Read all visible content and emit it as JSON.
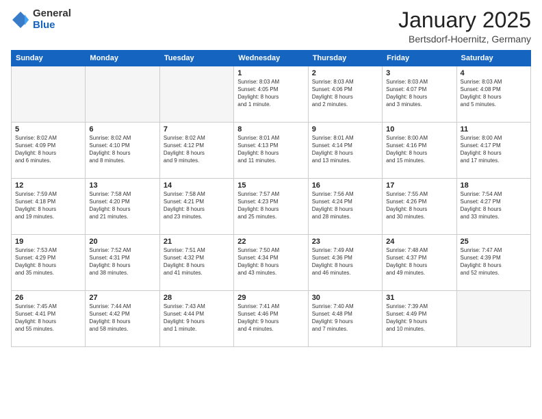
{
  "logo": {
    "general": "General",
    "blue": "Blue"
  },
  "title": "January 2025",
  "location": "Bertsdorf-Hoernitz, Germany",
  "weekdays": [
    "Sunday",
    "Monday",
    "Tuesday",
    "Wednesday",
    "Thursday",
    "Friday",
    "Saturday"
  ],
  "weeks": [
    [
      {
        "day": "",
        "content": ""
      },
      {
        "day": "",
        "content": ""
      },
      {
        "day": "",
        "content": ""
      },
      {
        "day": "1",
        "content": "Sunrise: 8:03 AM\nSunset: 4:05 PM\nDaylight: 8 hours\nand 1 minute."
      },
      {
        "day": "2",
        "content": "Sunrise: 8:03 AM\nSunset: 4:06 PM\nDaylight: 8 hours\nand 2 minutes."
      },
      {
        "day": "3",
        "content": "Sunrise: 8:03 AM\nSunset: 4:07 PM\nDaylight: 8 hours\nand 3 minutes."
      },
      {
        "day": "4",
        "content": "Sunrise: 8:03 AM\nSunset: 4:08 PM\nDaylight: 8 hours\nand 5 minutes."
      }
    ],
    [
      {
        "day": "5",
        "content": "Sunrise: 8:02 AM\nSunset: 4:09 PM\nDaylight: 8 hours\nand 6 minutes."
      },
      {
        "day": "6",
        "content": "Sunrise: 8:02 AM\nSunset: 4:10 PM\nDaylight: 8 hours\nand 8 minutes."
      },
      {
        "day": "7",
        "content": "Sunrise: 8:02 AM\nSunset: 4:12 PM\nDaylight: 8 hours\nand 9 minutes."
      },
      {
        "day": "8",
        "content": "Sunrise: 8:01 AM\nSunset: 4:13 PM\nDaylight: 8 hours\nand 11 minutes."
      },
      {
        "day": "9",
        "content": "Sunrise: 8:01 AM\nSunset: 4:14 PM\nDaylight: 8 hours\nand 13 minutes."
      },
      {
        "day": "10",
        "content": "Sunrise: 8:00 AM\nSunset: 4:16 PM\nDaylight: 8 hours\nand 15 minutes."
      },
      {
        "day": "11",
        "content": "Sunrise: 8:00 AM\nSunset: 4:17 PM\nDaylight: 8 hours\nand 17 minutes."
      }
    ],
    [
      {
        "day": "12",
        "content": "Sunrise: 7:59 AM\nSunset: 4:18 PM\nDaylight: 8 hours\nand 19 minutes."
      },
      {
        "day": "13",
        "content": "Sunrise: 7:58 AM\nSunset: 4:20 PM\nDaylight: 8 hours\nand 21 minutes."
      },
      {
        "day": "14",
        "content": "Sunrise: 7:58 AM\nSunset: 4:21 PM\nDaylight: 8 hours\nand 23 minutes."
      },
      {
        "day": "15",
        "content": "Sunrise: 7:57 AM\nSunset: 4:23 PM\nDaylight: 8 hours\nand 25 minutes."
      },
      {
        "day": "16",
        "content": "Sunrise: 7:56 AM\nSunset: 4:24 PM\nDaylight: 8 hours\nand 28 minutes."
      },
      {
        "day": "17",
        "content": "Sunrise: 7:55 AM\nSunset: 4:26 PM\nDaylight: 8 hours\nand 30 minutes."
      },
      {
        "day": "18",
        "content": "Sunrise: 7:54 AM\nSunset: 4:27 PM\nDaylight: 8 hours\nand 33 minutes."
      }
    ],
    [
      {
        "day": "19",
        "content": "Sunrise: 7:53 AM\nSunset: 4:29 PM\nDaylight: 8 hours\nand 35 minutes."
      },
      {
        "day": "20",
        "content": "Sunrise: 7:52 AM\nSunset: 4:31 PM\nDaylight: 8 hours\nand 38 minutes."
      },
      {
        "day": "21",
        "content": "Sunrise: 7:51 AM\nSunset: 4:32 PM\nDaylight: 8 hours\nand 41 minutes."
      },
      {
        "day": "22",
        "content": "Sunrise: 7:50 AM\nSunset: 4:34 PM\nDaylight: 8 hours\nand 43 minutes."
      },
      {
        "day": "23",
        "content": "Sunrise: 7:49 AM\nSunset: 4:36 PM\nDaylight: 8 hours\nand 46 minutes."
      },
      {
        "day": "24",
        "content": "Sunrise: 7:48 AM\nSunset: 4:37 PM\nDaylight: 8 hours\nand 49 minutes."
      },
      {
        "day": "25",
        "content": "Sunrise: 7:47 AM\nSunset: 4:39 PM\nDaylight: 8 hours\nand 52 minutes."
      }
    ],
    [
      {
        "day": "26",
        "content": "Sunrise: 7:45 AM\nSunset: 4:41 PM\nDaylight: 8 hours\nand 55 minutes."
      },
      {
        "day": "27",
        "content": "Sunrise: 7:44 AM\nSunset: 4:42 PM\nDaylight: 8 hours\nand 58 minutes."
      },
      {
        "day": "28",
        "content": "Sunrise: 7:43 AM\nSunset: 4:44 PM\nDaylight: 9 hours\nand 1 minute."
      },
      {
        "day": "29",
        "content": "Sunrise: 7:41 AM\nSunset: 4:46 PM\nDaylight: 9 hours\nand 4 minutes."
      },
      {
        "day": "30",
        "content": "Sunrise: 7:40 AM\nSunset: 4:48 PM\nDaylight: 9 hours\nand 7 minutes."
      },
      {
        "day": "31",
        "content": "Sunrise: 7:39 AM\nSunset: 4:49 PM\nDaylight: 9 hours\nand 10 minutes."
      },
      {
        "day": "",
        "content": ""
      }
    ]
  ]
}
